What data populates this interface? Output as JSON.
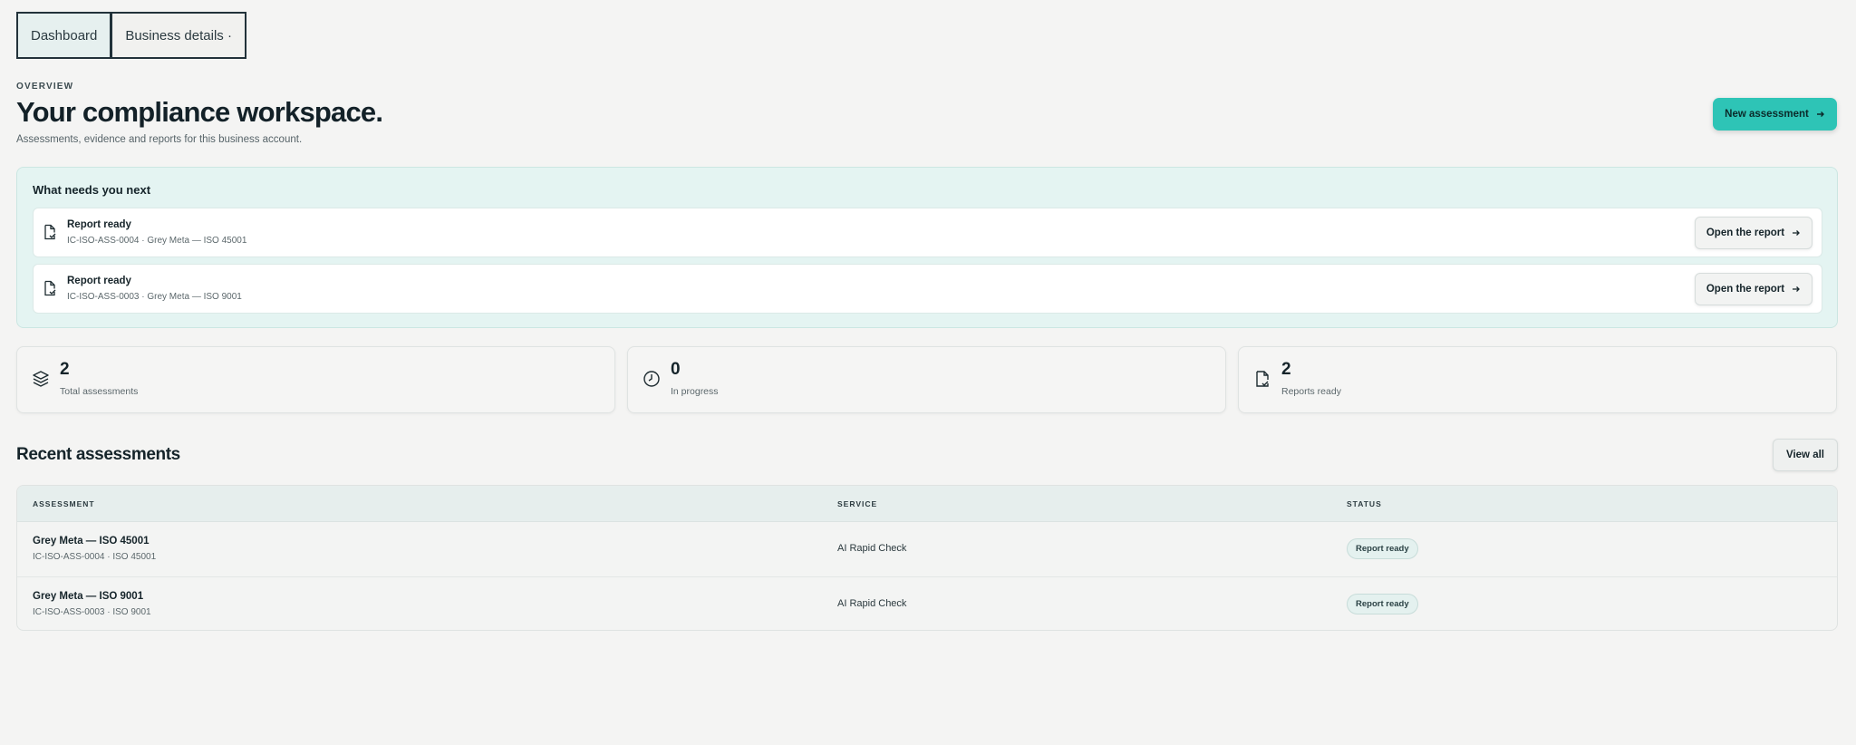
{
  "tabs": [
    {
      "label": "Dashboard"
    },
    {
      "label": "Business details ·"
    }
  ],
  "header": {
    "eyebrow": "OVERVIEW",
    "title": "Your compliance workspace.",
    "subtitle": "Assessments, evidence and reports for this business account.",
    "primary_button": "New assessment"
  },
  "next": {
    "title": "What needs you next",
    "items": [
      {
        "title": "Report ready",
        "detail": "IC-ISO-ASS-0004 · Grey Meta — ISO 45001",
        "action": "Open the report",
        "icon": "document-check-icon"
      },
      {
        "title": "Report ready",
        "detail": "IC-ISO-ASS-0003 · Grey Meta — ISO 9001",
        "action": "Open the report",
        "icon": "document-check-icon"
      }
    ]
  },
  "stats": [
    {
      "value": "2",
      "label": "Total assessments",
      "icon": "layers-icon"
    },
    {
      "value": "0",
      "label": "In progress",
      "icon": "clock-icon"
    },
    {
      "value": "2",
      "label": "Reports ready",
      "icon": "document-check-icon"
    }
  ],
  "recent": {
    "title": "Recent assessments",
    "view_all": "View all",
    "columns": [
      "ASSESSMENT",
      "SERVICE",
      "STATUS"
    ],
    "rows": [
      {
        "name": "Grey Meta — ISO 45001",
        "id": "IC-ISO-ASS-0004 · ISO 45001",
        "service": "AI Rapid Check",
        "status": "Report ready"
      },
      {
        "name": "Grey Meta — ISO 9001",
        "id": "IC-ISO-ASS-0003 · ISO 9001",
        "service": "AI Rapid Check",
        "status": "Report ready"
      }
    ]
  },
  "colors": {
    "accent": "#2ec4b6",
    "panel": "#e4f4f2",
    "background": "#f4f4f3",
    "text": "#15242a"
  }
}
